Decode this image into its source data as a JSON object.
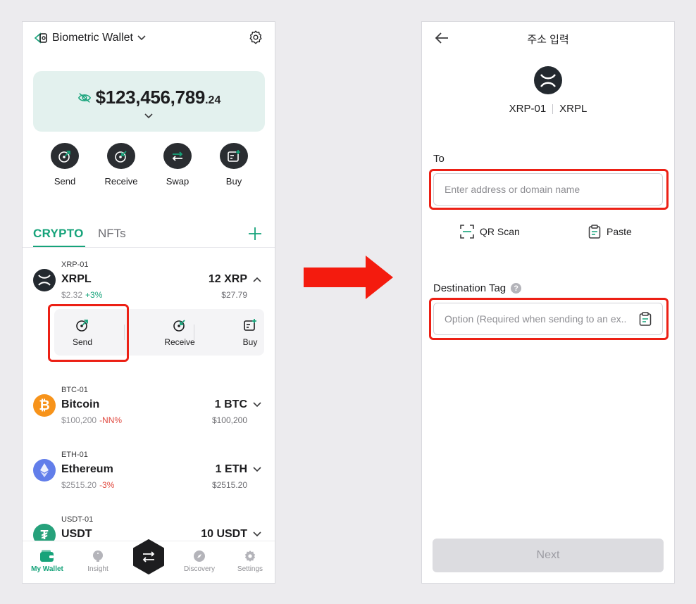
{
  "left": {
    "wallet_name": "Biometric Wallet",
    "balance_main": "$123,456,789",
    "balance_decimals": ".24",
    "quick_actions": [
      {
        "label": "Send",
        "icon": "send-icon"
      },
      {
        "label": "Receive",
        "icon": "receive-icon"
      },
      {
        "label": "Swap",
        "icon": "swap-icon"
      },
      {
        "label": "Buy",
        "icon": "buy-icon"
      }
    ],
    "tabs": {
      "crypto": "CRYPTO",
      "nfts": "NFTs"
    },
    "assets": [
      {
        "tag": "XRP-01",
        "name": "XRPL",
        "price": "$2.32",
        "change": "+3%",
        "amount": "12 XRP",
        "fiat": "$27.79",
        "icon": "xrp-icon"
      },
      {
        "tag": "BTC-01",
        "name": "Bitcoin",
        "price": "$100,200",
        "change": "-NN%",
        "amount": "1 BTC",
        "fiat": "$100,200",
        "icon": "bitcoin-icon"
      },
      {
        "tag": "ETH-01",
        "name": "Ethereum",
        "price": "$2515.20",
        "change": "-3%",
        "amount": "1 ETH",
        "fiat": "$2515.20",
        "icon": "ethereum-icon"
      },
      {
        "tag": "USDT-01",
        "name": "USDT",
        "price": "",
        "change": "",
        "amount": "10 USDT",
        "fiat": "",
        "icon": "tether-icon"
      }
    ],
    "expanded_actions": [
      {
        "label": "Send"
      },
      {
        "label": "Receive"
      },
      {
        "label": "Buy"
      }
    ],
    "bottom_nav": [
      {
        "label": "My Wallet",
        "active": true
      },
      {
        "label": "Insight",
        "active": false
      },
      {
        "label": "Discovery",
        "active": false
      },
      {
        "label": "Settings",
        "active": false
      }
    ]
  },
  "right": {
    "title": "주소 입력",
    "account_name": "XRP-01",
    "network": "XRPL",
    "to_label": "To",
    "to_placeholder": "Enter address or domain name",
    "qr_scan_label": "QR Scan",
    "paste_label": "Paste",
    "dest_tag_label": "Destination Tag",
    "dest_tag_help": "?",
    "dest_tag_placeholder": "Option (Required when sending to an ex..",
    "next_label": "Next"
  },
  "colors": {
    "accent_green": "#16a37a",
    "highlight_red": "#ec2015",
    "dark_icon": "#2a2d31",
    "card_bg": "#e3f1ee"
  }
}
